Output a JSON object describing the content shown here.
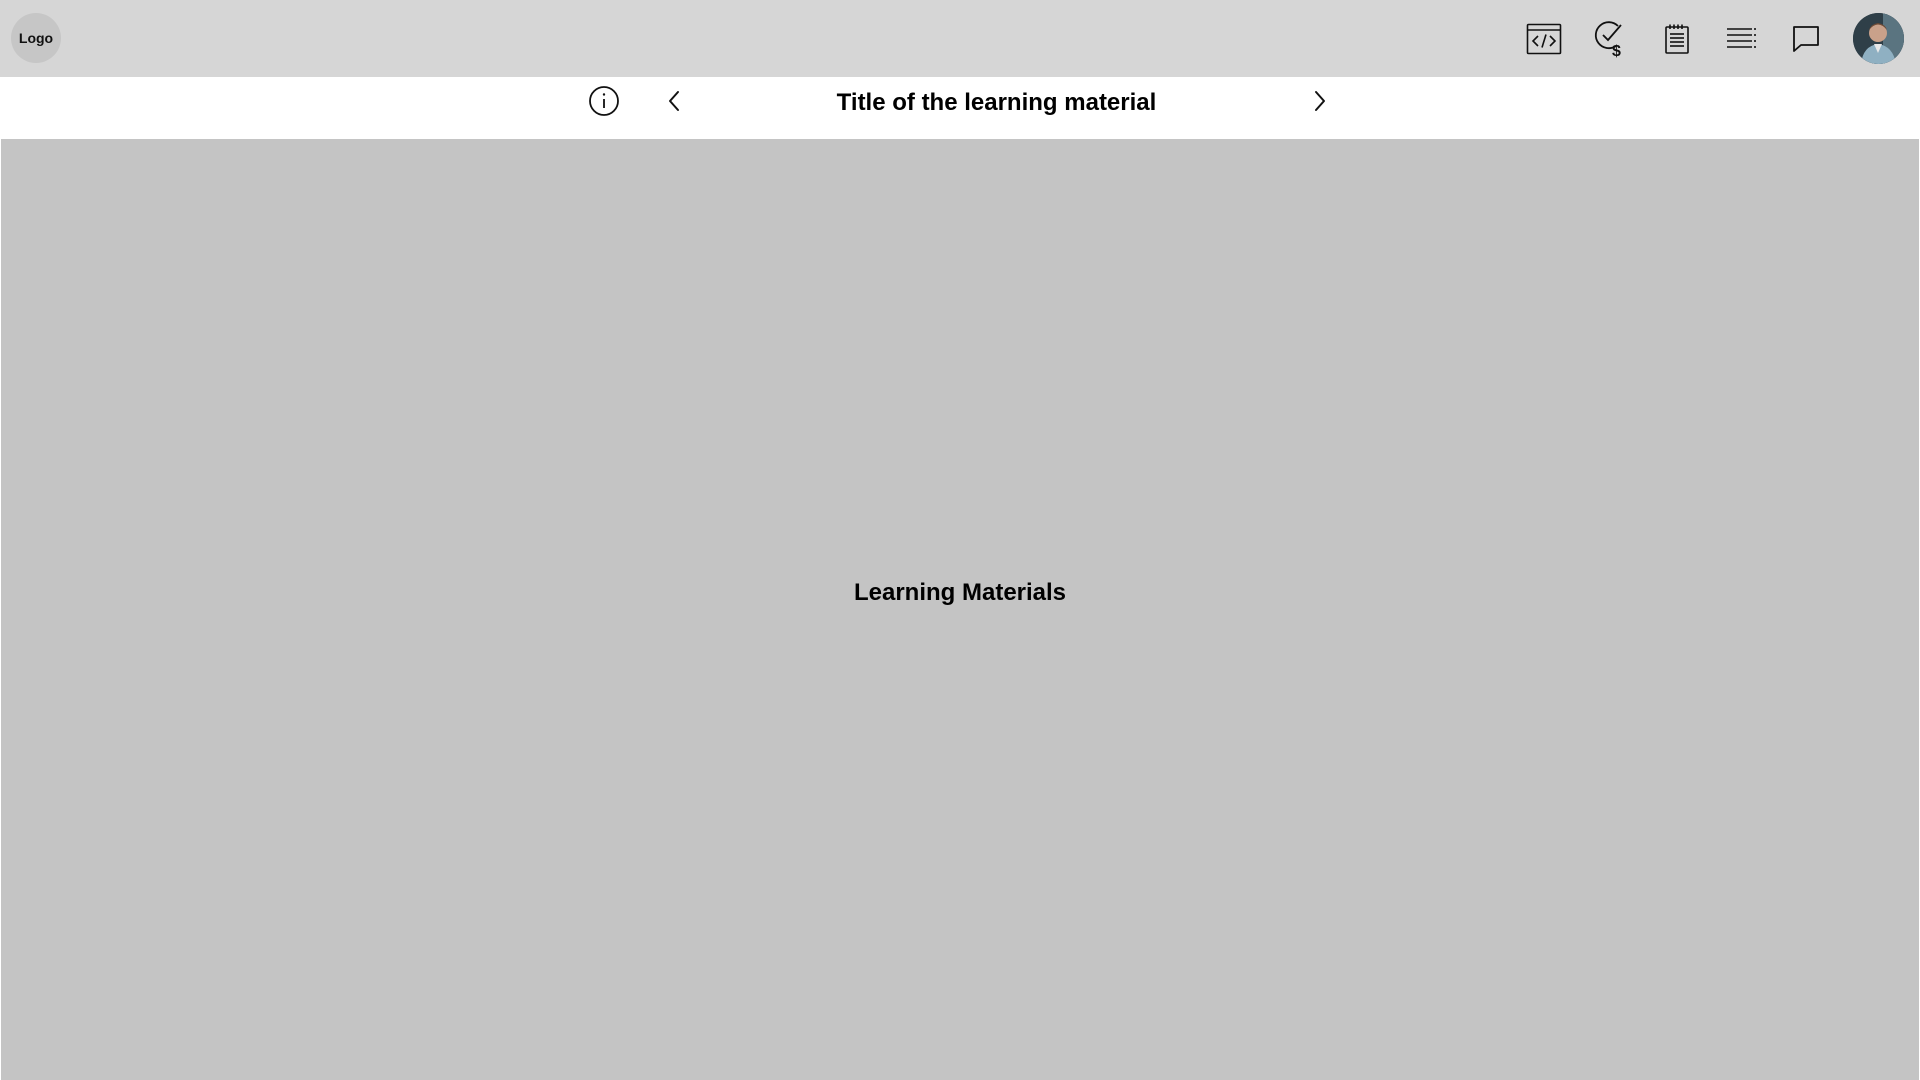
{
  "header": {
    "logo_text": "Logo",
    "toolbar": [
      {
        "icon": "code-window-icon"
      },
      {
        "icon": "check-dollar-icon"
      },
      {
        "icon": "notepad-icon"
      },
      {
        "icon": "list-icon"
      },
      {
        "icon": "chat-bubble-icon"
      }
    ],
    "avatar": {
      "icon": "user-avatar"
    }
  },
  "subheader": {
    "title": "Title of the learning material",
    "info_icon": "info-icon",
    "prev_icon": "chevron-left-icon",
    "next_icon": "chevron-right-icon"
  },
  "main": {
    "placeholder_label": "Learning Materials"
  },
  "colors": {
    "topbar_bg": "#d6d6d6",
    "logo_bg": "#c6c6c6",
    "content_bg": "#c4c4c4",
    "subbar_bg": "#ffffff"
  }
}
